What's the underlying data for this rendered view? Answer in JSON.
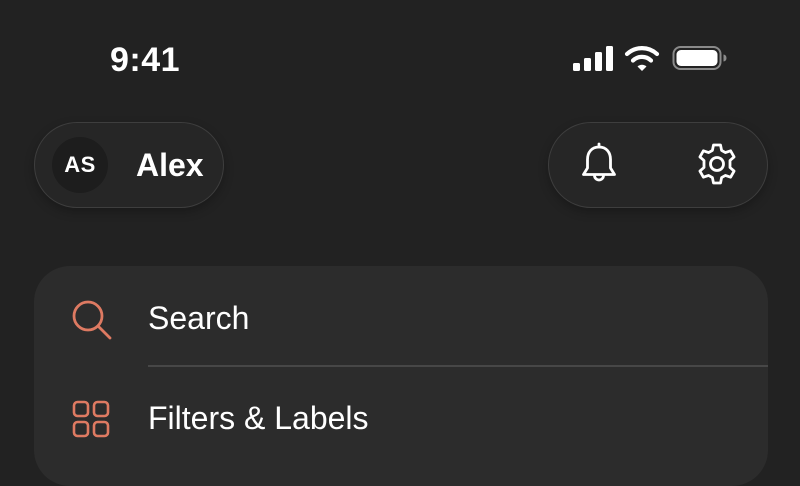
{
  "status_bar": {
    "time": "9:41",
    "icons": [
      "cellular-signal-icon",
      "wifi-icon",
      "battery-icon"
    ]
  },
  "profile": {
    "initials": "AS",
    "name": "Alex"
  },
  "header_actions": [
    {
      "name": "notifications",
      "icon": "bell-icon"
    },
    {
      "name": "settings",
      "icon": "gear-icon"
    }
  ],
  "menu": {
    "items": [
      {
        "label": "Search",
        "icon": "search-icon"
      },
      {
        "label": "Filters & Labels",
        "icon": "grid-icon"
      }
    ]
  },
  "colors": {
    "background": "#222222",
    "card": "#2c2c2c",
    "pill": "#262626",
    "accent": "#de7a62",
    "text": "#ffffff"
  }
}
